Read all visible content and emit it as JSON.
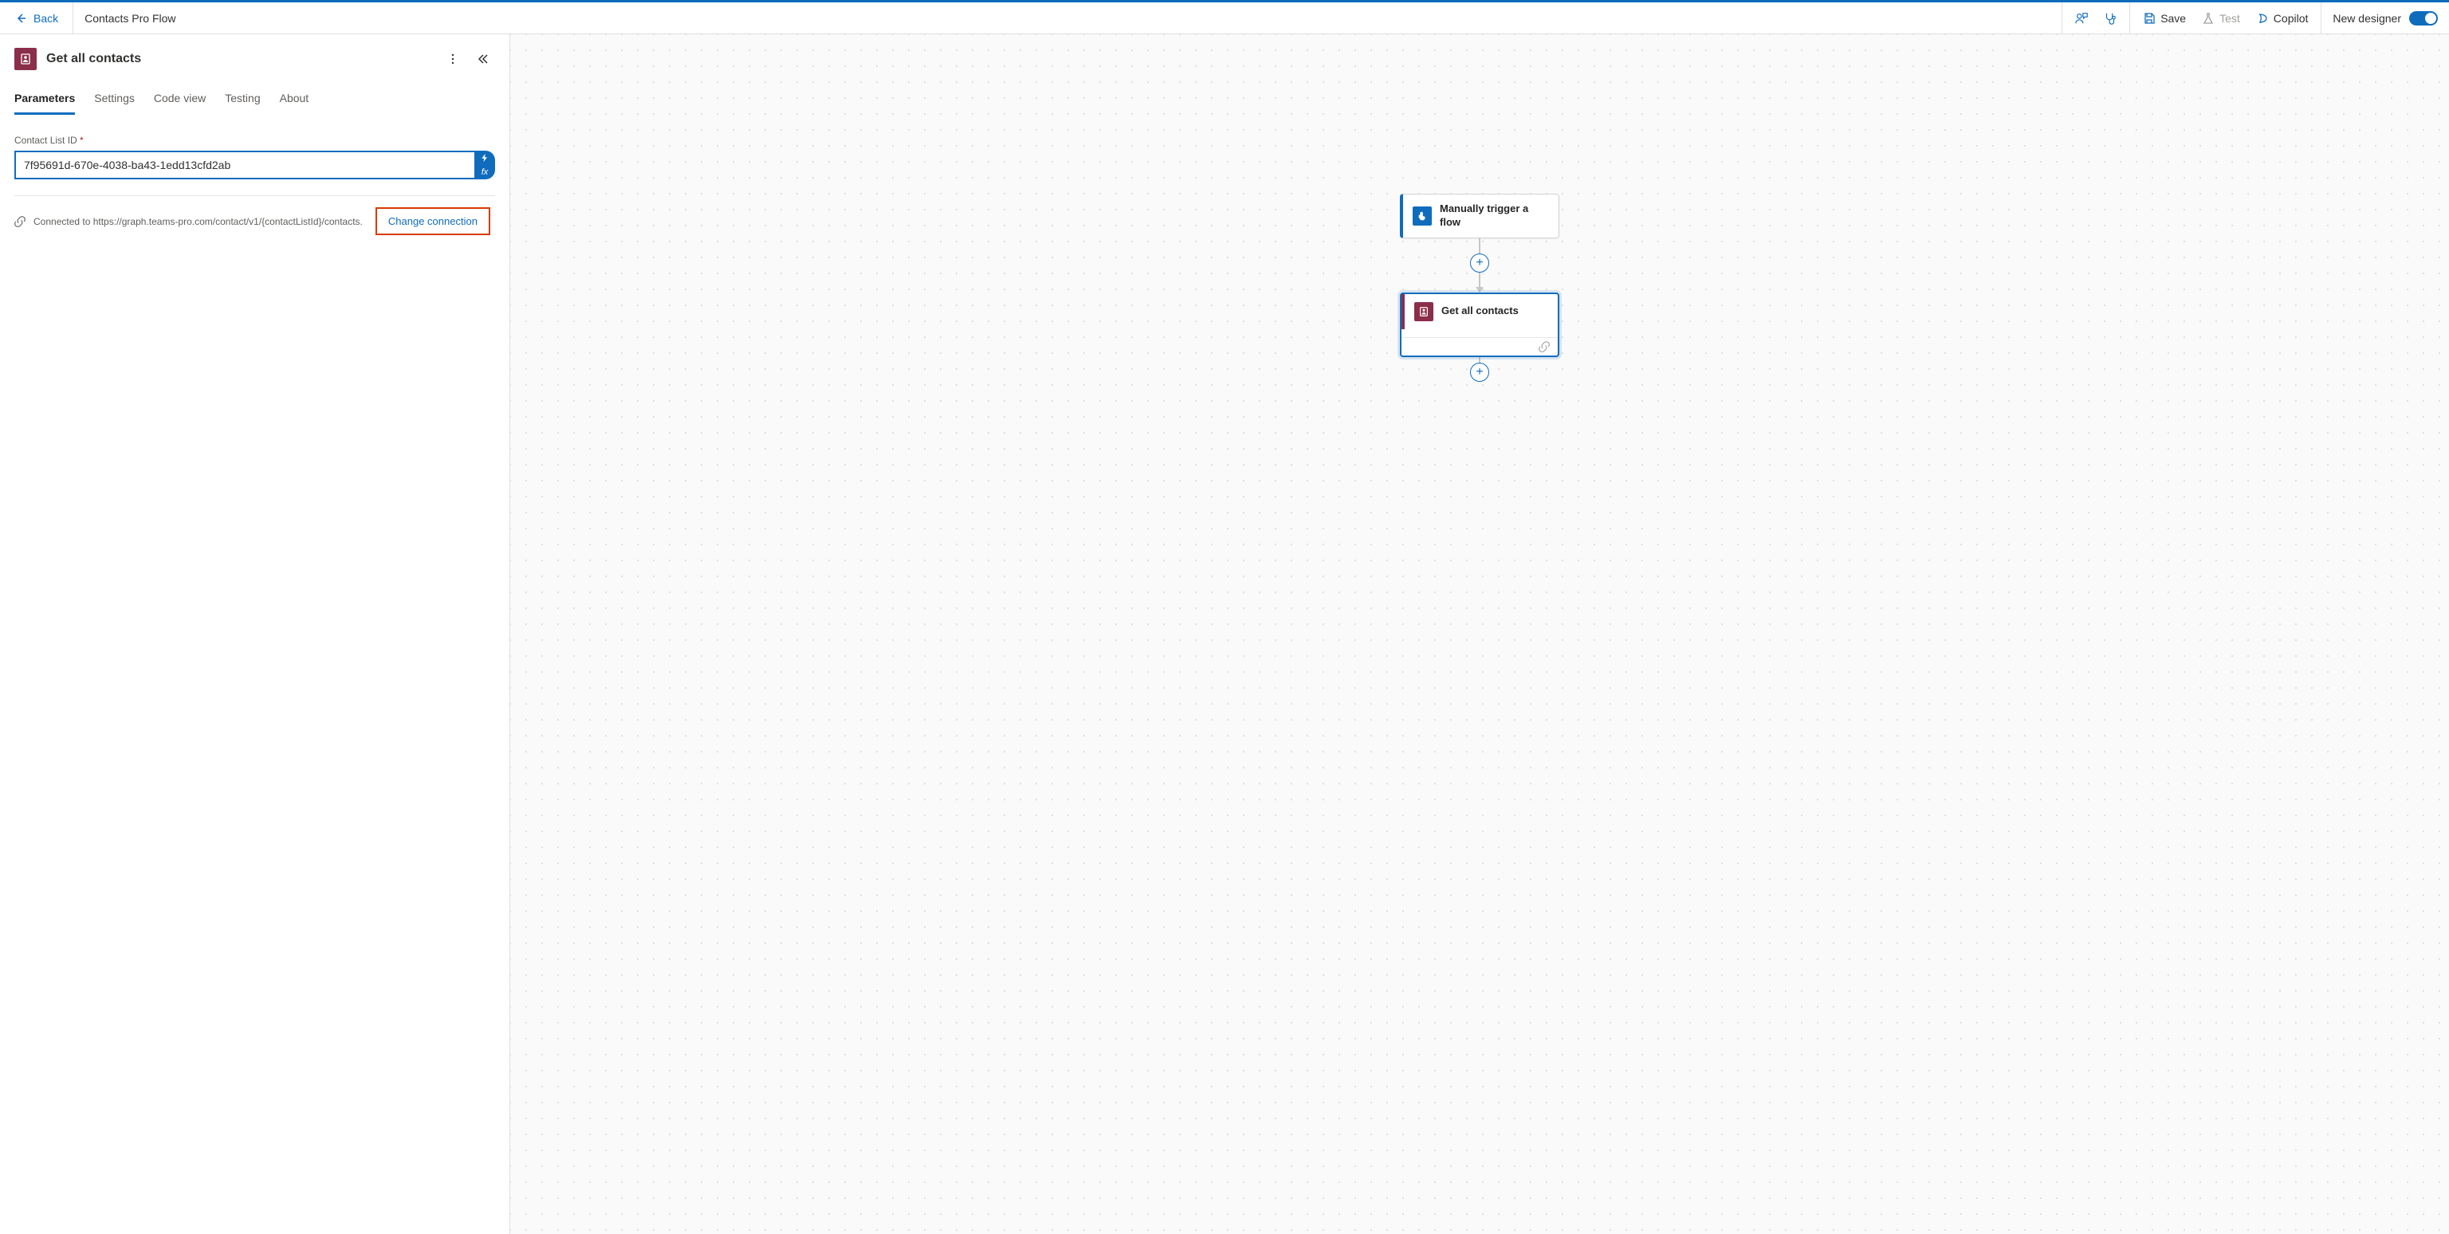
{
  "header": {
    "back_label": "Back",
    "flow_name": "Contacts Pro Flow",
    "save_label": "Save",
    "test_label": "Test",
    "copilot_label": "Copilot",
    "new_designer_label": "New designer"
  },
  "panel": {
    "title": "Get all contacts",
    "tabs": {
      "parameters": "Parameters",
      "settings": "Settings",
      "code_view": "Code view",
      "testing": "Testing",
      "about": "About"
    },
    "field": {
      "label": "Contact List ID",
      "required_mark": "*",
      "value": "7f95691d-670e-4038-ba43-1edd13cfd2ab"
    },
    "connection": {
      "text": "Connected to https://graph.teams-pro.com/contact/v1/{contactListId}/contacts.",
      "change_label": "Change connection"
    }
  },
  "canvas": {
    "trigger_label": "Manually trigger a flow",
    "action_label": "Get all contacts"
  }
}
